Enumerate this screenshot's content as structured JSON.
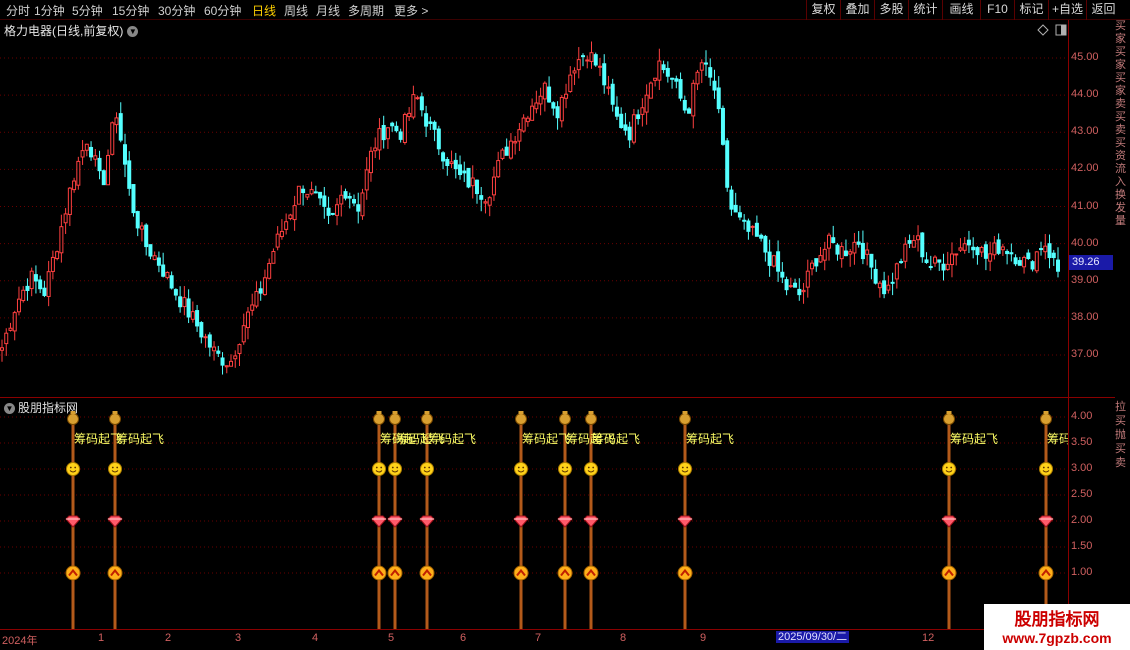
{
  "toolbar": {
    "timeframes": [
      {
        "label": "分时",
        "active": false
      },
      {
        "label": "1分钟",
        "active": false
      },
      {
        "label": "5分钟",
        "active": false
      },
      {
        "label": "15分钟",
        "active": false
      },
      {
        "label": "30分钟",
        "active": false
      },
      {
        "label": "60分钟",
        "active": false
      },
      {
        "label": "日线",
        "active": true
      },
      {
        "label": "周线",
        "active": false
      },
      {
        "label": "月线",
        "active": false
      },
      {
        "label": "多周期",
        "active": false
      },
      {
        "label": "更多 >",
        "active": false
      }
    ],
    "buttons": [
      "复权",
      "叠加",
      "多股",
      "统计",
      "画线",
      "F10",
      "标记",
      "+自选",
      "返回"
    ]
  },
  "main_chart": {
    "title": "格力电器(日线,前复权)",
    "y_ticks": [
      "45.00",
      "44.00",
      "43.00",
      "42.00",
      "41.00",
      "40.00",
      "39.00",
      "38.00",
      "37.00"
    ],
    "current_price": "39.26",
    "colors": {
      "up": "#ff4040",
      "down": "#54ffff",
      "grid": "#6a0000",
      "axis": "#d06060"
    }
  },
  "indicator": {
    "title": "股朋指标网",
    "y_ticks": [
      "4.00",
      "3.50",
      "3.00",
      "2.50",
      "2.00",
      "1.50",
      "1.00"
    ],
    "signal_label": "筹码起飞",
    "icons": [
      "money-bag-icon",
      "smiley-icon",
      "diamond-icon",
      "up-arrow-icon"
    ]
  },
  "date_axis": {
    "labels": [
      "2024年",
      "1",
      "2",
      "3",
      "4",
      "5",
      "6",
      "7",
      "8",
      "9",
      "12"
    ],
    "cursor_date": "2025/09/30/二"
  },
  "side_strip": {
    "upper": "买家买家买家卖买卖买资流入换发量",
    "lower": "拉买抛买卖"
  },
  "watermark": {
    "title": "股朋指标网",
    "url": "www.7gpzb.com"
  },
  "chart_data": {
    "type": "candlestick",
    "title": "格力电器(日线,前复权)",
    "ylim": [
      36.2,
      45.6
    ],
    "y_ticks": [
      45,
      44,
      43,
      42,
      41,
      40,
      39,
      38,
      37
    ],
    "x_month_labels": [
      "2024年",
      "1",
      "2",
      "3",
      "4",
      "5",
      "6",
      "7",
      "8",
      "9",
      "12"
    ],
    "approx_closes": [
      37.2,
      38.4,
      39.1,
      38.7,
      40.2,
      41.8,
      42.9,
      41.5,
      43.6,
      41.2,
      40.0,
      39.5,
      38.8,
      38.2,
      37.6,
      37.0,
      36.8,
      37.9,
      38.6,
      39.8,
      40.7,
      41.6,
      41.2,
      40.5,
      41.5,
      41.0,
      42.6,
      43.2,
      43.0,
      44.0,
      43.1,
      42.4,
      41.8,
      41.6,
      41.3,
      42.3,
      43.0,
      43.7,
      44.2,
      43.6,
      44.8,
      45.2,
      44.6,
      43.4,
      43.0,
      44.0,
      44.9,
      44.4,
      43.5,
      44.9,
      44.1,
      41.0,
      40.4,
      40.1,
      39.5,
      38.8,
      38.6,
      39.6,
      40.0,
      39.8,
      40.1,
      39.3,
      38.7,
      39.6,
      40.2,
      39.4,
      39.5,
      39.9,
      40.1,
      39.6,
      40.0,
      39.7,
      39.4,
      40.1,
      39.26
    ],
    "indicator": {
      "series_name": "筹码起飞",
      "levels": [
        4.0,
        3.0,
        2.0,
        1.0
      ],
      "signal_count": 12
    }
  }
}
